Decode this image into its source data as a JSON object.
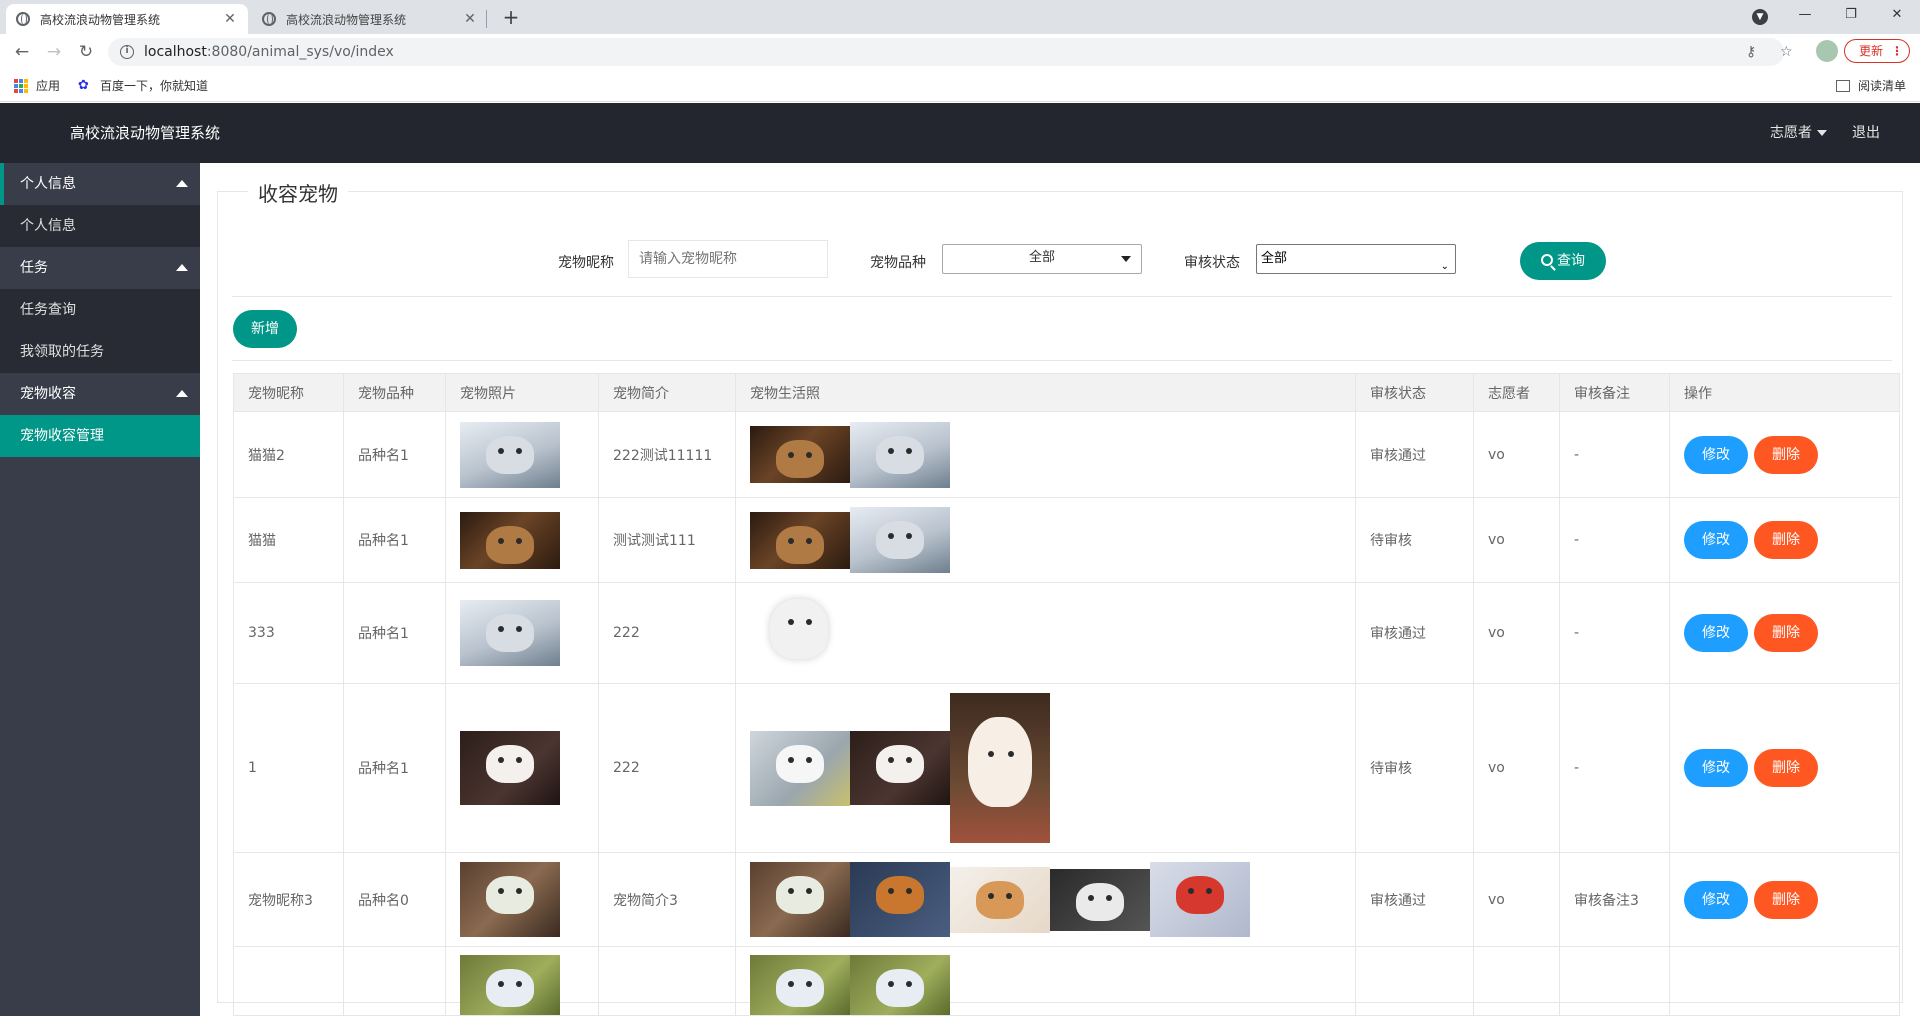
{
  "browser": {
    "tabs": [
      {
        "title": "高校流浪动物管理系统",
        "active": true
      },
      {
        "title": "高校流浪动物管理系统",
        "active": false
      }
    ],
    "url_host": "localhost",
    "url_rest": ":8080/animal_sys/vo/index",
    "update_label": "更新",
    "bookmarks": {
      "apps": "应用",
      "baidu": "百度一下，你就知道",
      "reading_list": "阅读清单"
    }
  },
  "header": {
    "title": "高校流浪动物管理系统",
    "user": "志愿者",
    "logout": "退出"
  },
  "sidebar": {
    "groups": [
      {
        "label": "个人信息",
        "items": [
          {
            "label": "个人信息",
            "active": false
          }
        ]
      },
      {
        "label": "任务",
        "items": [
          {
            "label": "任务查询",
            "active": false
          },
          {
            "label": "我领取的任务",
            "active": false
          }
        ]
      },
      {
        "label": "宠物收容",
        "items": [
          {
            "label": "宠物收容管理",
            "active": true
          }
        ]
      }
    ]
  },
  "main": {
    "legend": "收容宠物",
    "search": {
      "nickname_label": "宠物昵称",
      "nickname_placeholder": "请输入宠物昵称",
      "breed_label": "宠物品种",
      "breed_value": "全部",
      "status_label": "审核状态",
      "status_value": "全部",
      "query_label": "查询"
    },
    "add_label": "新增",
    "table": {
      "columns": [
        "宠物昵称",
        "宠物品种",
        "宠物照片",
        "宠物简介",
        "宠物生活照",
        "审核状态",
        "志愿者",
        "审核备注",
        "操作"
      ],
      "edit_label": "修改",
      "delete_label": "删除",
      "rows": [
        {
          "nickname": "猫猫2",
          "breed": "品种名1",
          "photo": "grey-cat-photo",
          "intro": "222测试11111",
          "life": [
            "tabby-cat-photo",
            "grey-cat-photo"
          ],
          "status": "审核通过",
          "volunteer": "vo",
          "remark": "-"
        },
        {
          "nickname": "猫猫",
          "breed": "品种名1",
          "photo": "tabby-cat-photo",
          "intro": "测试测试111",
          "life": [
            "tabby-cat-photo",
            "grey-cat-photo"
          ],
          "status": "待审核",
          "volunteer": "vo",
          "remark": "-"
        },
        {
          "nickname": "333",
          "breed": "品种名1",
          "photo": "grey-cat-photo",
          "intro": "222",
          "life": [
            "white-persian-photo"
          ],
          "status": "审核通过",
          "volunteer": "vo",
          "remark": "-"
        },
        {
          "nickname": "1",
          "breed": "品种名1",
          "photo": "white-kitten-photo",
          "intro": "222",
          "life": [
            "white-kitten-light-photo",
            "white-kitten-photo",
            "white-kitten-tall-photo"
          ],
          "status": "待审核",
          "volunteer": "vo",
          "remark": "-"
        },
        {
          "nickname": "宠物昵称3",
          "breed": "品种名0",
          "photo": "hamster-photo",
          "intro": "宠物简介3",
          "life": [
            "hamster-photo",
            "guinea-pig-photo",
            "two-kittens-photo",
            "husky-puppies-photo",
            "santa-pets-photo"
          ],
          "status": "审核通过",
          "volunteer": "vo",
          "remark": "审核备注3"
        },
        {
          "nickname": "",
          "breed": "",
          "photo": "bird-photo",
          "intro": "",
          "life": [
            "bird-photo",
            "bird-photo"
          ],
          "status": "",
          "volunteer": "",
          "remark": ""
        }
      ]
    }
  }
}
